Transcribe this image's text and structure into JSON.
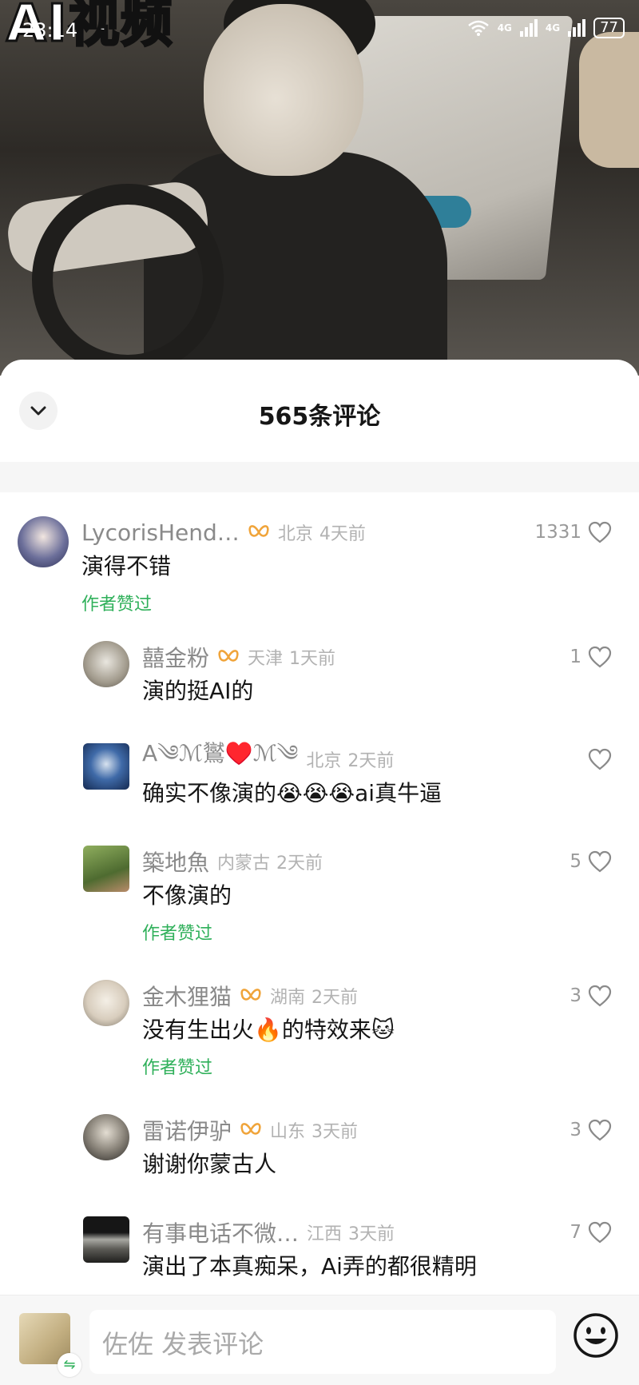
{
  "video": {
    "overlay_text": "AI视频"
  },
  "status_bar": {
    "time": "23:14",
    "network_1": "4G",
    "network_2": "4G",
    "battery": "77"
  },
  "sheet": {
    "title": "565条评论",
    "collapse_icon": "chevron-down-icon"
  },
  "comments": [
    {
      "username": "LycorisHend…",
      "has_badge": true,
      "location": "北京",
      "time_ago": "4天前",
      "text": "演得不错",
      "author_liked": "作者赞过",
      "likes": "1331",
      "avatar_color": "#3b3f6b"
    },
    {
      "username": "囍金粉",
      "has_badge": true,
      "location": "天津",
      "time_ago": "1天前",
      "text": "演的挺AI的",
      "likes": "1",
      "avatar_color": "#9a9485"
    },
    {
      "username": "A༄ℳ鸑♥️ℳ༄",
      "has_badge": false,
      "location": "北京",
      "time_ago": "2天前",
      "text": "确实不像演的😭😭😭ai真牛逼",
      "likes": "",
      "avatar_color": "#2a4d8a"
    },
    {
      "username": "築地魚",
      "has_badge": false,
      "location": "内蒙古",
      "time_ago": "2天前",
      "text": "不像演的",
      "author_liked": "作者赞过",
      "likes": "5",
      "avatar_color": "#5f7a3e"
    },
    {
      "username": "金木狸猫",
      "has_badge": true,
      "location": "湖南",
      "time_ago": "2天前",
      "text": "没有生出火🔥的特效来🐱",
      "author_liked": "作者赞过",
      "likes": "3",
      "avatar_color": "#cfc6b8"
    },
    {
      "username": "雷诺伊驴",
      "has_badge": true,
      "location": "山东",
      "time_ago": "3天前",
      "text": "谢谢你蒙古人",
      "likes": "3",
      "avatar_color": "#6a655e"
    },
    {
      "username": "有事电话不微…",
      "has_badge": false,
      "location": "江西",
      "time_ago": "3天前",
      "text": "演出了本真痴呆，Ai弄的都很精明",
      "likes": "7",
      "avatar_color": "#3b3a36"
    }
  ],
  "bottom_bar": {
    "input_placeholder": "佐佐 发表评论",
    "emoji_icon": "smiley-icon"
  },
  "colors": {
    "author_liked": "#2fb05a",
    "badge": "#f0a43a",
    "meta_gray": "#b2b2b2"
  }
}
